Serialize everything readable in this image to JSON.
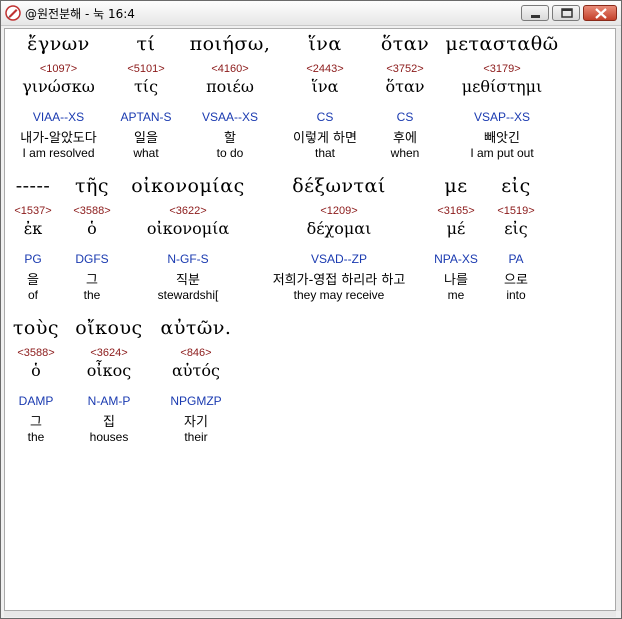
{
  "window": {
    "title": "@원전분해 - 눅 16:4",
    "controls": {
      "minimize": "minimize-icon",
      "maximize": "maximize-icon",
      "close": "close-icon"
    }
  },
  "rows": [
    [
      {
        "greek": "ἔγνων",
        "strong": "<1097>",
        "lemma": "γινώσκω",
        "parse": "VIAA--XS",
        "korean": "내가-알았도다",
        "english": "I am resolved"
      },
      {
        "greek": "τί",
        "strong": "<5101>",
        "lemma": "τίς",
        "parse": "APTAN-S",
        "korean": "일을",
        "english": "what"
      },
      {
        "greek": "ποιήσω,",
        "strong": "<4160>",
        "lemma": "ποιέω",
        "parse": "VSAA--XS",
        "korean": "할",
        "english": "to do"
      },
      {
        "greek": "ἵνα",
        "strong": "<2443>",
        "lemma": "ἵνα",
        "parse": "CS",
        "korean": "이렇게 하면",
        "english": "that"
      },
      {
        "greek": "ὅταν",
        "strong": "<3752>",
        "lemma": "ὅταν",
        "parse": "CS",
        "korean": "후에",
        "english": "when"
      },
      {
        "greek": "μετασταθῶ",
        "strong": "<3179>",
        "lemma": "μεθίστημι",
        "parse": "VSAP--XS",
        "korean": "빼앗긴",
        "english": "I am put out"
      }
    ],
    [
      {
        "greek": "-----",
        "strong": "<1537>",
        "lemma": "ἐκ",
        "parse": "PG",
        "korean": "을",
        "english": "of"
      },
      {
        "greek": "τῆς",
        "strong": "<3588>",
        "lemma": "ὁ",
        "parse": "DGFS",
        "korean": "그",
        "english": "the"
      },
      {
        "greek": "οἰκονομίας",
        "strong": "<3622>",
        "lemma": "οἰκονομία",
        "parse": "N-GF-S",
        "korean": "직분",
        "english": "stewardshi["
      },
      {
        "greek": "δέξωνταί",
        "strong": "<1209>",
        "lemma": "δέχομαι",
        "parse": "VSAD--ZP",
        "korean": "저희가-영접 하리라 하고",
        "english": "they may receive"
      },
      {
        "greek": "με",
        "strong": "<3165>",
        "lemma": "μέ",
        "parse": "NPA-XS",
        "korean": "나를",
        "english": "me"
      },
      {
        "greek": "εἰς",
        "strong": "<1519>",
        "lemma": "εἰς",
        "parse": "PA",
        "korean": "으로",
        "english": "into"
      }
    ],
    [
      {
        "greek": "τοὺς",
        "strong": "<3588>",
        "lemma": "ὁ",
        "parse": "DAMP",
        "korean": "그",
        "english": "the"
      },
      {
        "greek": "οἴκους",
        "strong": "<3624>",
        "lemma": "οἶκος",
        "parse": "N-AM-P",
        "korean": "집",
        "english": "houses"
      },
      {
        "greek": "αὐτῶν.",
        "strong": "<846>",
        "lemma": "αὐτός",
        "parse": "NPGMZP",
        "korean": "자기",
        "english": "their"
      }
    ]
  ]
}
